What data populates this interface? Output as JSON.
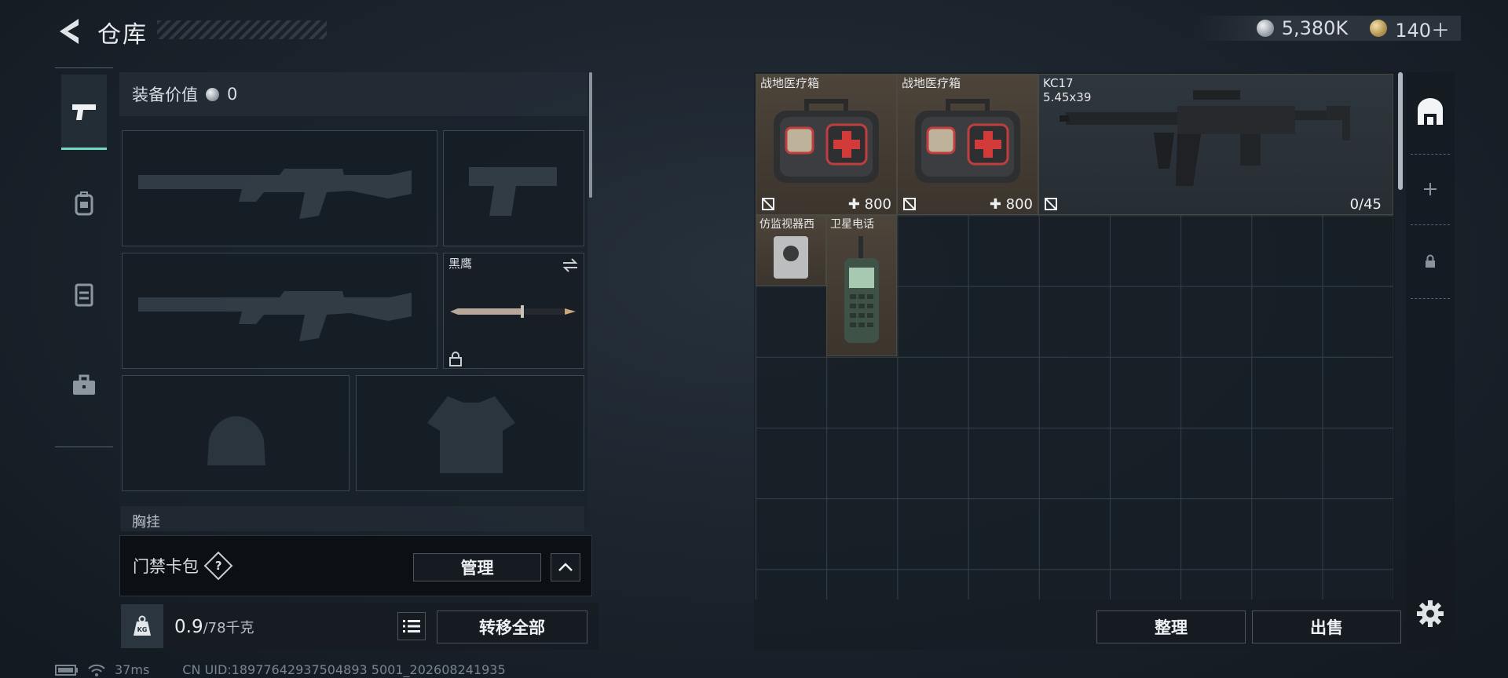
{
  "header": {
    "title": "仓库"
  },
  "currency": {
    "silver": "5,380K",
    "gold": "140＋"
  },
  "equipment": {
    "value_label": "装备价值",
    "value": "0",
    "knife_name": "黑鹰",
    "chest_label": "胸挂"
  },
  "keycard": {
    "label": "门禁卡包",
    "help": "?",
    "manage": "管理"
  },
  "weight": {
    "current": "0.9",
    "max": "/78千克"
  },
  "transfer_all": "转移全部",
  "status": {
    "ping": "37ms",
    "uid": "CN UID:18977642937504893 5001_202608241935"
  },
  "storage": {
    "items": [
      {
        "name": "战地医疗箱",
        "value": "800"
      },
      {
        "name": "战地医疗箱",
        "value": "800"
      },
      {
        "name": "KC17",
        "sub": "5.45x39",
        "ammo": "0/45"
      },
      {
        "name": "仿监视器西"
      },
      {
        "name": "卫星电话"
      }
    ]
  },
  "actions": {
    "sort": "整理",
    "sell": "出售"
  },
  "colors": {
    "accent": "#6fdcc0",
    "item_brown": "#4d443a",
    "grid_line": "#35404a"
  }
}
